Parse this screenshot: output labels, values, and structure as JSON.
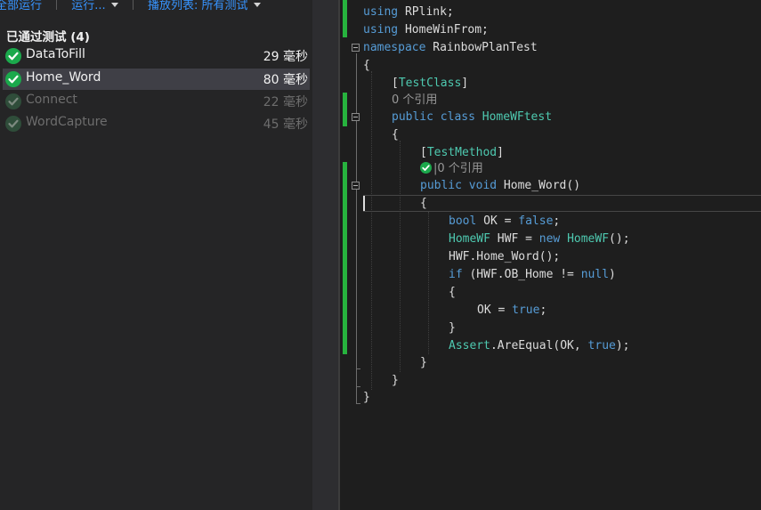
{
  "toolbar": {
    "run_all": "全部运行",
    "run": "运行...",
    "playlist": "播放列表: 所有测试"
  },
  "test_explorer": {
    "group_header": "已通过测试 (4)",
    "tests": [
      {
        "name": "DataToFill",
        "time": "29 毫秒",
        "status": "passed"
      },
      {
        "name": "Home_Word",
        "time": "80 毫秒",
        "status": "passed",
        "selected": true
      },
      {
        "name": "Connect",
        "time": "22 毫秒",
        "status": "passed",
        "dimmed": true
      },
      {
        "name": "WordCapture",
        "time": "45 毫秒",
        "status": "passed",
        "dimmed": true
      }
    ]
  },
  "editor": {
    "codelens": {
      "class_refs": "0 个引用",
      "method_refs": "|0 个引用"
    },
    "line1": {
      "k": "using",
      "t": " RPlink;"
    },
    "line2": {
      "k": "using",
      "t": " HomeWinFrom;"
    },
    "line3": {
      "k": "namespace",
      "t": " RainbowPlanTest"
    },
    "line4": {
      "t": "{"
    },
    "line5": {
      "a": "[",
      "b": "TestClass",
      "c": "]"
    },
    "line7": {
      "k1": "public",
      "k2": "class",
      "ty": "HomeWFtest"
    },
    "line8": {
      "t": "{"
    },
    "line9": {
      "a": "[",
      "b": "TestMethod",
      "c": "]"
    },
    "line11": {
      "k1": "public",
      "k2": "void",
      "t": " Home_Word()"
    },
    "line12": {
      "t": "{"
    },
    "line13": {
      "k1": "bool",
      "t1": " OK = ",
      "k2": "false",
      "t2": ";"
    },
    "line14": {
      "ty1": "HomeWF",
      "t1": " HWF = ",
      "k": "new",
      "ty2": "HomeWF",
      "t2": "();"
    },
    "line15": {
      "t": "HWF.Home_Word();"
    },
    "line16": {
      "k1": "if",
      "t1": " (HWF.OB_Home != ",
      "k2": "null",
      "t2": ")"
    },
    "line17": {
      "t": "{"
    },
    "line18": {
      "t1": "OK = ",
      "k": "true",
      "t2": ";"
    },
    "line19": {
      "t": "}"
    },
    "line20": {
      "ty": "Assert",
      "t1": ".AreEqual(OK, ",
      "k": "true",
      "t2": ");"
    },
    "line21": {
      "t": "}"
    },
    "line22": {
      "t": "}"
    },
    "line23": {
      "t": "}"
    }
  },
  "colors": {
    "pass_green": "#1ba94c",
    "change_bar": "#27b33e",
    "keyword": "#569cd6",
    "type": "#4ec9b0",
    "link_blue": "#3794ff"
  },
  "icons": [
    "pass-check-icon",
    "dropdown-caret-icon",
    "fold-toggle-icon"
  ]
}
